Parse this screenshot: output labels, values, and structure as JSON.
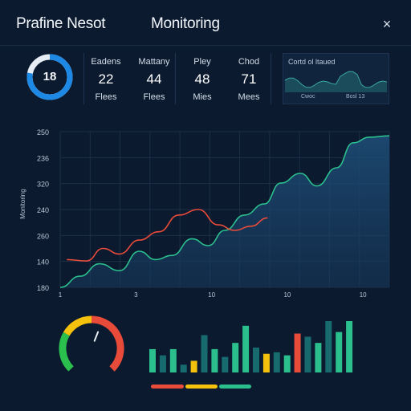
{
  "header": {
    "app_title": "Prafine Nesot",
    "page_title": "Monitoring",
    "close_icon": "close-icon",
    "close_glyph": "×"
  },
  "ring": {
    "value": "18",
    "progress": 0.78,
    "colors": {
      "track": "#e6edf5",
      "fill": "#1e88e5"
    }
  },
  "stats": [
    {
      "label": "Eadens",
      "value": "22",
      "unit": "Flees"
    },
    {
      "label": "Mattany",
      "value": "44",
      "unit": "Flees"
    },
    {
      "label": "Pley",
      "value": "48",
      "unit": "Mies"
    },
    {
      "label": "Chod",
      "value": "71",
      "unit": "Mees"
    }
  ],
  "mini_chart": {
    "title": "Cortd ol ltaued",
    "foot_left": "Cwoc",
    "foot_right": "Bosl 13"
  },
  "chart_data": {
    "type": "area",
    "ylabel": "Monitoring",
    "y_ticks": [
      "250",
      "236",
      "320",
      "240",
      "260",
      "140",
      "180"
    ],
    "x_ticks": [
      "1",
      "3",
      "10",
      "10",
      "10"
    ],
    "series": [
      {
        "color": "#2bbf8e",
        "x": [
          0,
          0.06,
          0.12,
          0.18,
          0.24,
          0.29,
          0.34,
          0.4,
          0.45,
          0.5,
          0.56,
          0.62,
          0.67,
          0.73,
          0.78,
          0.84,
          0.89,
          0.94,
          1.0
        ],
        "y": [
          0.0,
          0.08,
          0.17,
          0.12,
          0.26,
          0.2,
          0.23,
          0.35,
          0.3,
          0.41,
          0.52,
          0.6,
          0.75,
          0.82,
          0.73,
          0.86,
          1.04,
          1.08,
          1.09
        ]
      },
      {
        "color": "#e84b3a",
        "x": [
          0.02,
          0.08,
          0.13,
          0.18,
          0.24,
          0.3,
          0.36,
          0.42,
          0.48,
          0.53,
          0.58,
          0.63
        ],
        "y": [
          0.2,
          0.19,
          0.28,
          0.24,
          0.34,
          0.4,
          0.52,
          0.56,
          0.45,
          0.41,
          0.44,
          0.5
        ]
      }
    ]
  },
  "gauge": {
    "colors": [
      "#2bbf4e",
      "#f4c20d",
      "#e84b3a"
    ],
    "needle_value": 0.58,
    "needle_color": "#e8eef6"
  },
  "bottom_bars": {
    "values": [
      0.3,
      0.22,
      0.3,
      0.1,
      0.15,
      0.48,
      0.3,
      0.2,
      0.38,
      0.6,
      0.32,
      0.24,
      0.26,
      0.22,
      0.5,
      0.46,
      0.38,
      0.66,
      0.52,
      0.66
    ],
    "colors": [
      "#2bbf8e",
      "#176b6e",
      "#2bbf8e",
      "#176b6e",
      "#f4c20d",
      "#176b6e",
      "#2bbf8e",
      "#176b6e",
      "#2bbf8e",
      "#2bbf8e",
      "#176b6e",
      "#f4c20d",
      "#176b6e",
      "#2bbf8e",
      "#e84b3a",
      "#176b6e",
      "#2bbf8e",
      "#176b6e",
      "#2bbf8e",
      "#2bbf8e"
    ]
  },
  "legend_bars": [
    {
      "color": "#e84b3a"
    },
    {
      "color": "#f4c20d"
    },
    {
      "color": "#2bbf8e"
    }
  ]
}
